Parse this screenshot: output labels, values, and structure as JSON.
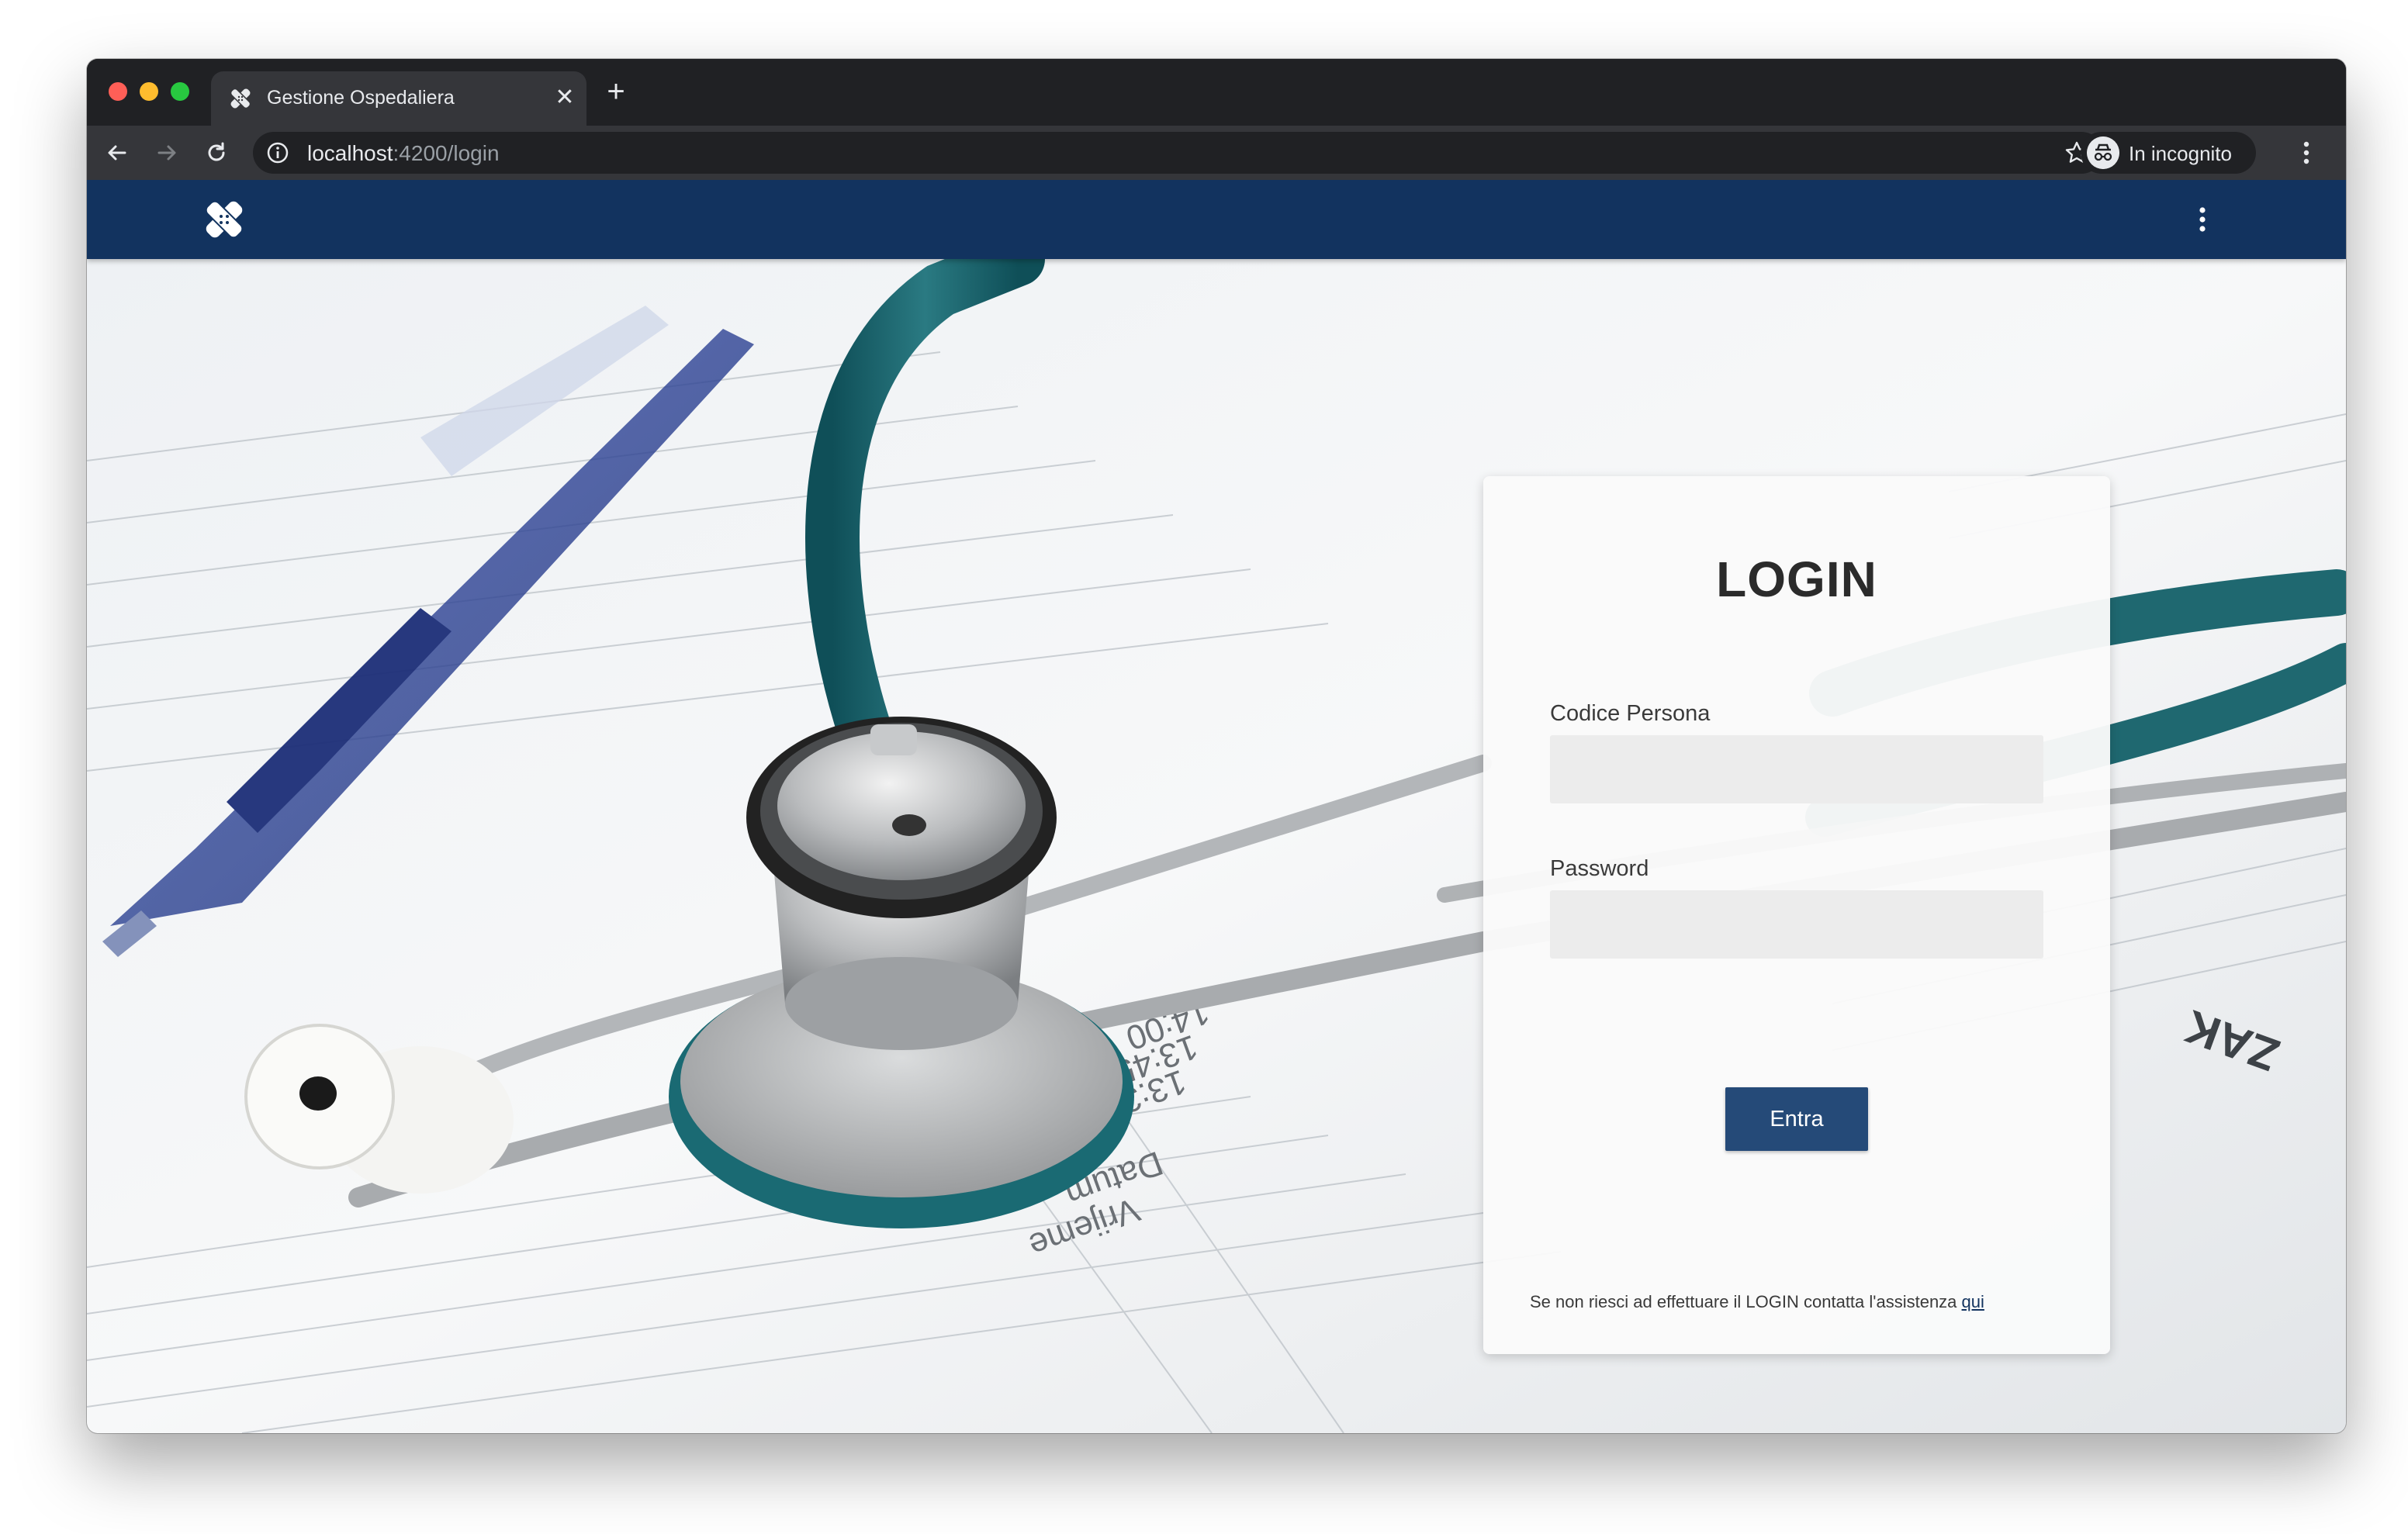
{
  "browser": {
    "tab_title": "Gestione Ospedaliera",
    "tab_close": "✕",
    "new_tab": "+",
    "url_host": "localhost",
    "url_path": ":4200/login",
    "incognito_label": "In incognito"
  },
  "icons": {
    "back": "arrow-left-icon",
    "forward": "arrow-right-icon",
    "reload": "reload-icon",
    "info": "info-icon",
    "bookmark": "star-icon",
    "incognito": "incognito-icon",
    "browser_menu": "more-vertical-icon",
    "app_logo": "bandage-cross-logo",
    "app_menu": "more-vertical-icon"
  },
  "colors": {
    "appbar": "#12335f",
    "button": "#254a78",
    "link": "#12335f"
  },
  "login": {
    "title": "LOGIN",
    "code_label": "Codice Persona",
    "code_value": "",
    "password_label": "Password",
    "password_value": "",
    "submit_label": "Entra",
    "help_text": "Se non riesci ad effettuare il LOGIN contatta l'assistenza",
    "help_link": "qui"
  },
  "background_text": {
    "datum": "Datum",
    "vrijeme": "Vrijeme",
    "t1": "13:30",
    "t2": "13:45",
    "t3": "14:00",
    "zak": "ZAK"
  }
}
